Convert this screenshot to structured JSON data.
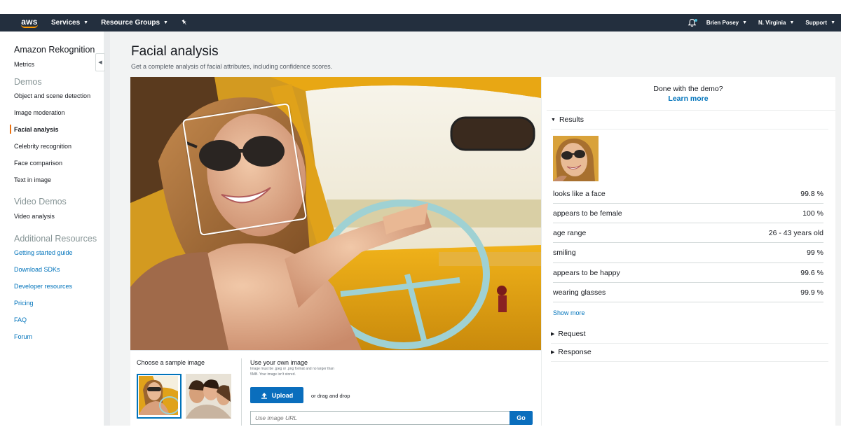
{
  "navbar": {
    "logo_text": "aws",
    "services_label": "Services",
    "resource_groups_label": "Resource Groups",
    "user_label": "Brien Posey",
    "region_label": "N. Virginia",
    "support_label": "Support"
  },
  "sidebar": {
    "service_title": "Amazon Rekognition",
    "metrics_label": "Metrics",
    "demos_heading": "Demos",
    "demos": [
      {
        "label": "Object and scene detection",
        "active": false
      },
      {
        "label": "Image moderation",
        "active": false
      },
      {
        "label": "Facial analysis",
        "active": true
      },
      {
        "label": "Celebrity recognition",
        "active": false
      },
      {
        "label": "Face comparison",
        "active": false
      },
      {
        "label": "Text in image",
        "active": false
      }
    ],
    "video_heading": "Video Demos",
    "video_demos": [
      {
        "label": "Video analysis"
      }
    ],
    "resources_heading": "Additional Resources",
    "resources": [
      {
        "label": "Getting started guide"
      },
      {
        "label": "Download SDKs"
      },
      {
        "label": "Developer resources"
      },
      {
        "label": "Pricing"
      },
      {
        "label": "FAQ"
      },
      {
        "label": "Forum"
      }
    ]
  },
  "page": {
    "title": "Facial analysis",
    "subtitle": "Get a complete analysis of facial attributes, including confidence scores."
  },
  "samples": {
    "heading": "Choose a sample image"
  },
  "upload": {
    "heading": "Use your own image",
    "note": "Image must be .jpeg or .png format and no larger than 5MB. Your image isn't stored.",
    "upload_label": "Upload",
    "drag_text": "or drag and drop",
    "url_placeholder": "Use image URL",
    "go_label": "Go"
  },
  "results": {
    "done_text": "Done with the demo?",
    "learn_more": "Learn more",
    "results_heading": "Results",
    "attributes": [
      {
        "label": "looks like a face",
        "value": "99.8 %"
      },
      {
        "label": "appears to be female",
        "value": "100 %"
      },
      {
        "label": "age range",
        "value": "26 - 43 years old"
      },
      {
        "label": "smiling",
        "value": "99 %"
      },
      {
        "label": "appears to be happy",
        "value": "99.6 %"
      },
      {
        "label": "wearing glasses",
        "value": "99.9 %"
      }
    ],
    "show_more": "Show more",
    "request_heading": "Request",
    "response_heading": "Response"
  },
  "colors": {
    "navbar_bg": "#232f3e",
    "accent_orange": "#ec7211",
    "link_blue": "#0073bb",
    "button_blue": "#0a6ebd"
  }
}
